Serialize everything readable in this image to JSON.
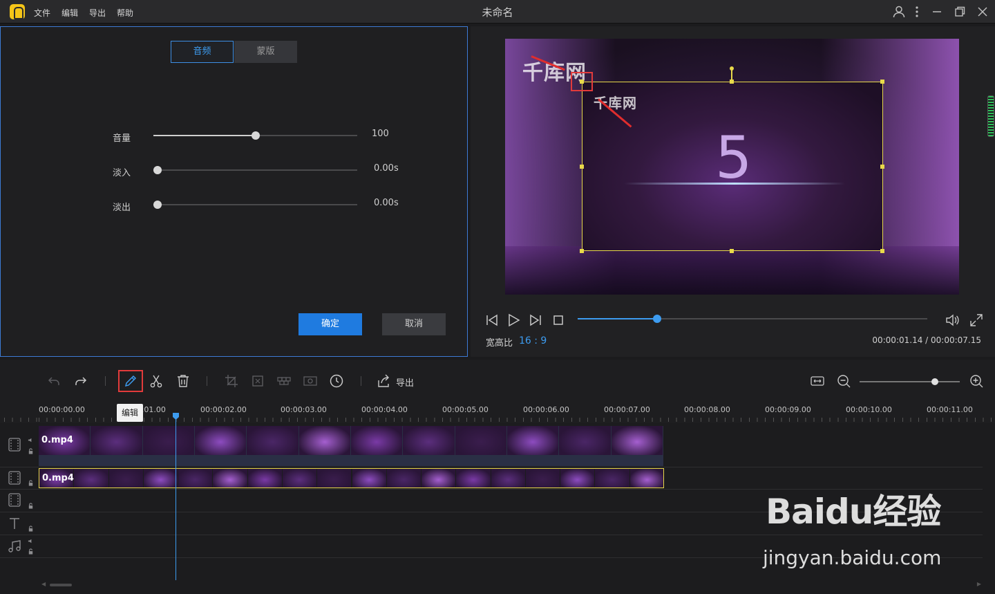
{
  "menu": [
    "文件",
    "编辑",
    "导出",
    "帮助"
  ],
  "window_title": "未命名",
  "left_panel": {
    "tabs": [
      {
        "label": "音频",
        "active": true
      },
      {
        "label": "蒙版",
        "active": false
      }
    ],
    "sliders": [
      {
        "label": "音量",
        "value": "100",
        "fraction": 0.5
      },
      {
        "label": "淡入",
        "value": "0.00s",
        "fraction": 0.02
      },
      {
        "label": "淡出",
        "value": "0.00s",
        "fraction": 0.02
      }
    ],
    "confirm_label": "确定",
    "cancel_label": "取消"
  },
  "preview": {
    "watermark_text": "千库网",
    "countdown_digit": "5",
    "aspect_label": "宽高比",
    "aspect_value": "16 : 9",
    "time_readout": "00:00:01.14 / 00:00:07.15",
    "progress_fraction": 0.227
  },
  "toolbar": {
    "export_label": "导出",
    "tooltip": "编辑",
    "zoom_fraction": 0.75
  },
  "ruler": [
    "00:00:00.00",
    "00:00:01.00",
    "00:00:02.00",
    "00:00:03.00",
    "00:00:04.00",
    "00:00:05.00",
    "00:00:06.00",
    "00:00:07.00",
    "00:00:08.00",
    "00:00:09.00",
    "00:00:10.00",
    "00:00:11.00"
  ],
  "tracks": {
    "clip1_name": "0.mp4",
    "clip2_name": "0.mp4"
  },
  "baidu": {
    "logo_text": "Baidu经验",
    "url": "jingyan.baidu.com"
  },
  "colors": {
    "accent": "#3d9cf0",
    "confirm": "#1f7be0",
    "selection": "#e8d94a",
    "annotation": "#e23b3b"
  }
}
